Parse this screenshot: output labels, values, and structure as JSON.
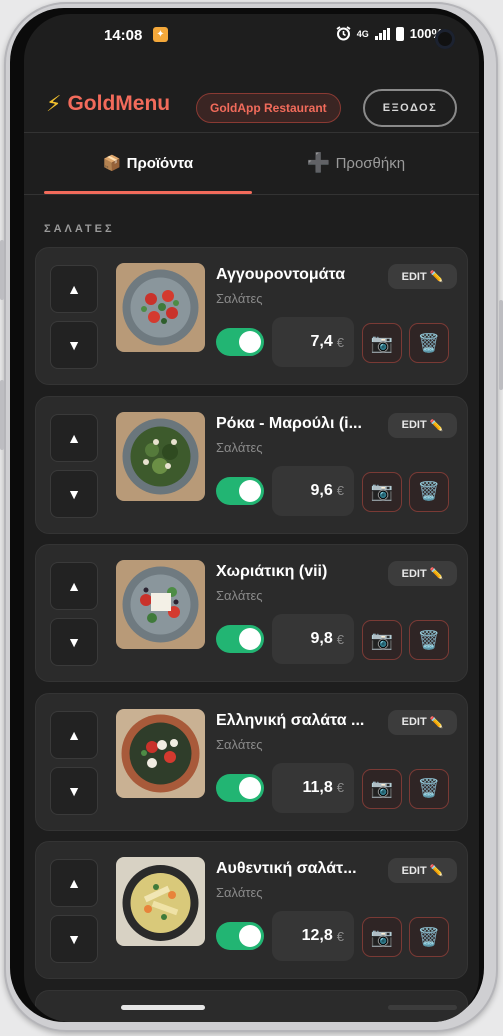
{
  "status_bar": {
    "time": "14:08",
    "network": "4G",
    "battery": "100%",
    "app_icon": "notification-app-icon",
    "alarm_icon": "alarm-icon"
  },
  "header": {
    "brand_icon": "bolt-icon",
    "brand_name": "GoldMenu",
    "restaurant_badge": "GoldApp Restaurant",
    "logout_label": "ΕΞΟΔΟΣ"
  },
  "tabs": [
    {
      "icon": "📦",
      "label": "Προϊόντα",
      "active": true
    },
    {
      "icon": "➕",
      "label": "Προσθήκη",
      "active": false
    }
  ],
  "section_title": "ΣΑΛΑΤΕΣ",
  "labels": {
    "edit": "EDIT",
    "edit_icon": "✏️",
    "currency": "€",
    "up_arrow": "▲",
    "down_arrow": "▼",
    "camera_icon": "📷",
    "trash_icon": "🗑️"
  },
  "products": [
    {
      "name": "Αγγουροντομάτα",
      "category": "Σαλάτες",
      "price": "7,4",
      "enabled": true,
      "image": "tomato-cucumber-salad"
    },
    {
      "name": "Ρόκα - Μαρούλι (i...",
      "category": "Σαλάτες",
      "price": "9,6",
      "enabled": true,
      "image": "rocket-lettuce-salad"
    },
    {
      "name": "Χωριάτικη (vii)",
      "category": "Σαλάτες",
      "price": "9,8",
      "enabled": true,
      "image": "greek-village-salad"
    },
    {
      "name": "Ελληνική σαλάτα ...",
      "category": "Σαλάτες",
      "price": "11,8",
      "enabled": true,
      "image": "greek-salad-bowl"
    },
    {
      "name": "Αυθεντική σαλάτ...",
      "category": "Σαλάτες",
      "price": "12,8",
      "enabled": true,
      "image": "pasta-salad"
    }
  ],
  "colors": {
    "accent": "#f26b5b",
    "toggle_on": "#22b573",
    "background": "#1e1e1e",
    "card": "#2b2b2b",
    "brand_bolt": "#f2c12e"
  }
}
